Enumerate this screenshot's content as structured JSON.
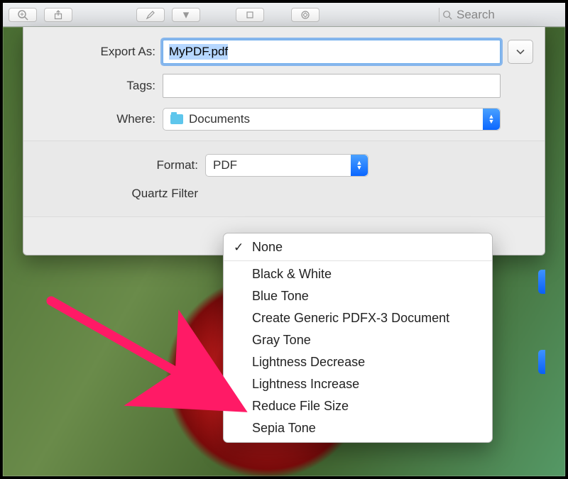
{
  "toolbar": {
    "search_placeholder": "Search"
  },
  "dialog": {
    "exportAs_label": "Export As:",
    "exportAs_value": "MyPDF.pdf",
    "tags_label": "Tags:",
    "tags_value": "",
    "where_label": "Where:",
    "where_value": "Documents",
    "format_label": "Format:",
    "format_value": "PDF",
    "quartz_label": "Quartz Filter"
  },
  "quartz_menu": {
    "selected": "None",
    "items": [
      "Black & White",
      "Blue Tone",
      "Create Generic PDFX-3 Document",
      "Gray Tone",
      "Lightness Decrease",
      "Lightness Increase",
      "Reduce File Size",
      "Sepia Tone"
    ]
  }
}
